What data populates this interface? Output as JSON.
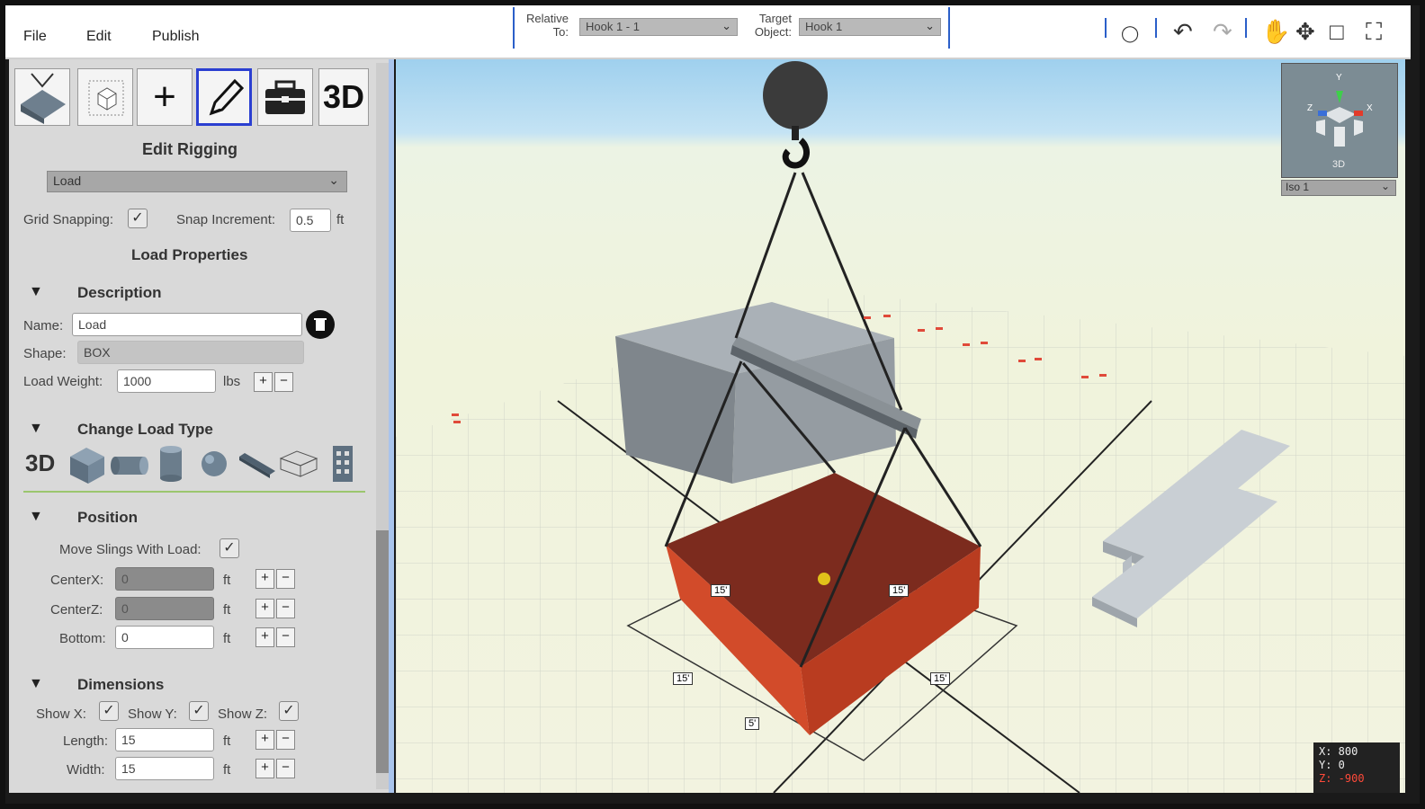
{
  "menu": {
    "file": "File",
    "edit": "Edit",
    "publish": "Publish"
  },
  "relative": {
    "relative_to_label_1": "Relative",
    "relative_to_label_2": "To:",
    "relative_to_value": "Hook 1 - 1",
    "target_label_1": "Target",
    "target_label_2": "Object:",
    "target_value": "Hook 1"
  },
  "toolbar": {
    "tool_3d": "3D"
  },
  "panel": {
    "title": "Edit Rigging",
    "object_select": "Load",
    "grid_snapping_label": "Grid Snapping:",
    "snap_increment_label": "Snap Increment:",
    "snap_increment_value": "0.5",
    "unit_ft": "ft",
    "load_properties": "Load Properties",
    "description": {
      "heading": "Description",
      "name_label": "Name:",
      "name_value": "Load",
      "shape_label": "Shape:",
      "shape_value": "BOX",
      "weight_label": "Load Weight:",
      "weight_value": "1000",
      "weight_unit": "lbs"
    },
    "change_type": {
      "heading": "Change Load Type",
      "type_3d": "3D"
    },
    "position": {
      "heading": "Position",
      "move_slings_label": "Move Slings With Load:",
      "centerx_label": "CenterX:",
      "centerx_value": "0",
      "centerz_label": "CenterZ:",
      "centerz_value": "0",
      "bottom_label": "Bottom:",
      "bottom_value": "0"
    },
    "dimensions": {
      "heading": "Dimensions",
      "show_x": "Show X:",
      "show_y": "Show Y:",
      "show_z": "Show Z:",
      "length_label": "Length:",
      "length_value": "15",
      "width_label": "Width:",
      "width_value": "15"
    }
  },
  "viewport": {
    "dim_top_left": "15'",
    "dim_top_right": "15'",
    "dim_bottom_left": "15'",
    "dim_bottom_right": "15'",
    "dim_height": "5'",
    "view_select": "Iso 1",
    "minimap_label": "3D",
    "axis_y": "Y",
    "axis_x": "X",
    "axis_z": "Z",
    "coord_x": "X: 800",
    "coord_y": "Y: 0",
    "coord_z": "Z: -900"
  },
  "colors": {
    "accent": "#2b5fc9",
    "load": "#c3401f",
    "active_tool": "#2b3fd1"
  }
}
